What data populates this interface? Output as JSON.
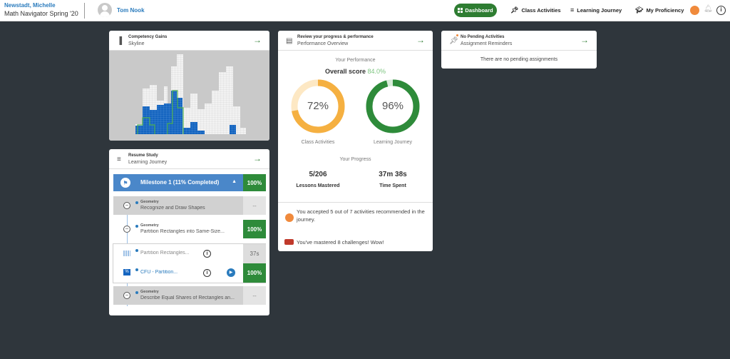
{
  "header": {
    "student_name": "Newstadt, Michelle",
    "course": "Math Navigator Spring '20",
    "teacher": "Tom Nook",
    "nav": {
      "dashboard": "Dashboard",
      "class_activities": "Class Activities",
      "learning_journey": "Learning Journey",
      "my_proficiency": "My Proficiency"
    },
    "accent_color": "#2e7d32"
  },
  "competency": {
    "title": "Competency Gains",
    "subtitle": "Skyline"
  },
  "resume": {
    "title": "Resume Study",
    "subtitle": "Learning Journey",
    "milestone": {
      "label": "Milestone 1 (11% Completed)",
      "percent": "100%"
    },
    "items": [
      {
        "subject": "Geometry",
        "title": "Recognize and Draw Shapes",
        "status": "--"
      },
      {
        "subject": "Geometry",
        "title": "Partition Rectangles into Same-Size...",
        "status": "100%"
      },
      {
        "subject": "",
        "title": "Partition Rectangles...",
        "status": "37s"
      },
      {
        "subject": "",
        "title": "CFU - Partition...",
        "status": "100%"
      },
      {
        "subject": "Geometry",
        "title": "Describe Equal Shares of Rectangles an...",
        "status": "--"
      }
    ]
  },
  "performance": {
    "title": "Review your progress & performance",
    "subtitle": "Performance Overview",
    "your_performance": "Your Performance",
    "overall_label": "Overall score",
    "overall_value": "84.0%",
    "class_activities": {
      "value": "72%",
      "label": "Class Activities",
      "fraction": 0.72,
      "color": "#f5b041"
    },
    "learning_journey": {
      "value": "96%",
      "label": "Learning Journey",
      "fraction": 0.96,
      "color": "#2e8b3a"
    },
    "your_progress": "Your Progress",
    "lessons": {
      "value": "5/206",
      "label": "Lessons Mastered"
    },
    "time": {
      "value": "37m 38s",
      "label": "Time Spent"
    },
    "notes": [
      "You accepted 5 out of 7 activities recommended in the journey.",
      "You've mastered 8 challenges! Wow!"
    ]
  },
  "pending": {
    "title": "No Pending Activities",
    "subtitle": "Assignment Reminders",
    "message": "There are no pending assignments"
  }
}
